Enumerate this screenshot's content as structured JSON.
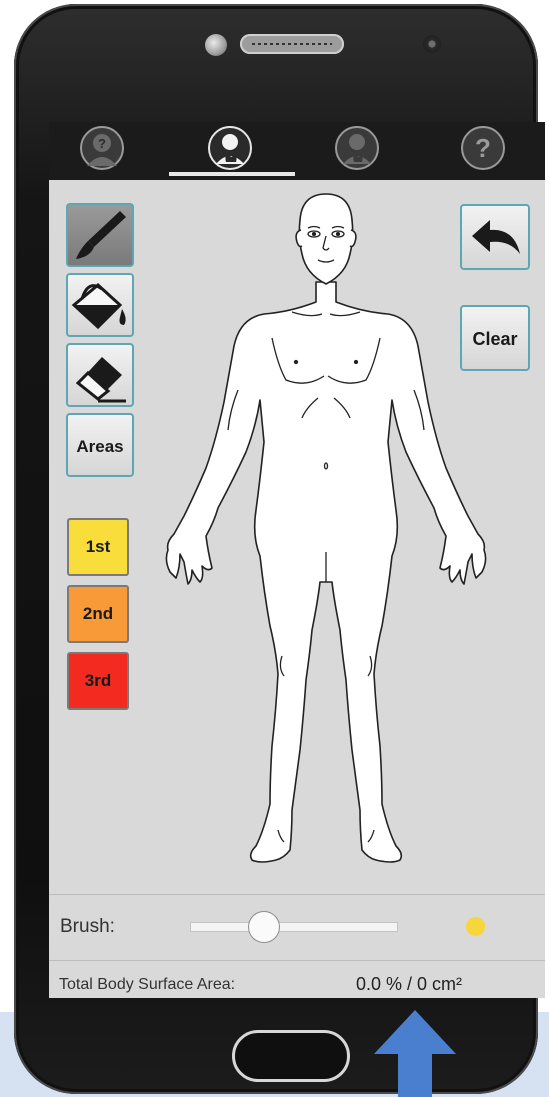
{
  "tabs": [
    {
      "icon": "person-question-icon",
      "active": false
    },
    {
      "icon": "person-burn-icon",
      "active": true
    },
    {
      "icon": "person-burn-back-icon",
      "active": false
    },
    {
      "icon": "help-icon",
      "active": false
    }
  ],
  "tools": {
    "brush_icon": "paintbrush-icon",
    "fill_icon": "paint-bucket-icon",
    "eraser_icon": "eraser-icon",
    "areas_label": "Areas"
  },
  "degrees": [
    {
      "label": "1st",
      "color": "#f9de3b"
    },
    {
      "label": "2nd",
      "color": "#f89a38"
    },
    {
      "label": "3rd",
      "color": "#f22a20"
    }
  ],
  "actions": {
    "undo_icon": "undo-arrow-icon",
    "clear_label": "Clear"
  },
  "brush": {
    "label": "Brush:",
    "size_fraction": 0.33,
    "color": "#f6d63a"
  },
  "tbsa": {
    "label": "Total Body Surface Area:",
    "value": "0.0 % / 0 cm²"
  },
  "colors": {
    "accent": "#5da6b4",
    "arrow": "#4a7fd0"
  }
}
